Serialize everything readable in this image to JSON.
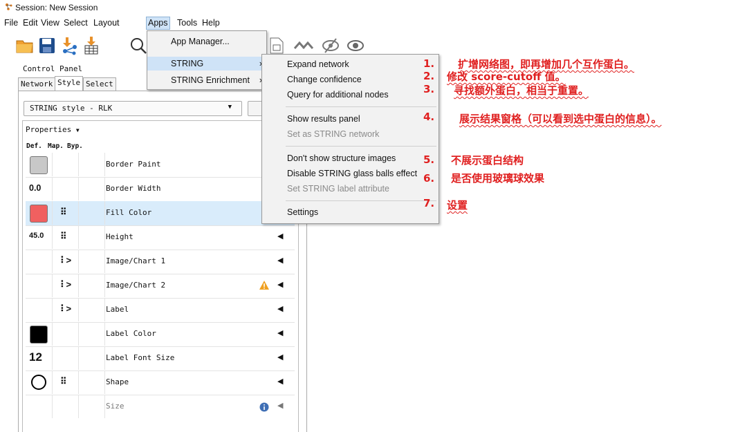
{
  "window": {
    "title": "Session: New Session"
  },
  "menubar": {
    "items": [
      "File",
      "Edit",
      "View",
      "Select",
      "Layout",
      "Apps",
      "Tools",
      "Help"
    ]
  },
  "apps_menu": {
    "items": [
      {
        "label": "App Manager...",
        "submenu": false
      },
      {
        "label": "STRING",
        "submenu": true
      },
      {
        "label": "STRING Enrichment",
        "submenu": true
      }
    ]
  },
  "string_menu": {
    "items": [
      {
        "label": "Expand network",
        "enabled": true
      },
      {
        "label": "Change confidence",
        "enabled": true
      },
      {
        "label": "Query for additional nodes",
        "enabled": true
      },
      {
        "label": "Show results panel",
        "enabled": true
      },
      {
        "label": "Set as STRING network",
        "enabled": false
      },
      {
        "label": "Don't show structure images",
        "enabled": true
      },
      {
        "label": "Disable STRING glass balls effect",
        "enabled": true
      },
      {
        "label": "Set STRING label attribute",
        "enabled": false
      },
      {
        "label": "Settings",
        "enabled": true
      }
    ]
  },
  "control_panel": {
    "title": "Control Panel",
    "tabs": [
      "Network",
      "Style",
      "Select"
    ],
    "style_selected": "STRING style - RLK",
    "properties_label": "Properties",
    "columns": [
      "Def.",
      "Map.",
      "Byp."
    ],
    "rows": [
      {
        "name": "Border Paint",
        "default": "",
        "swatch": "#c8c8c8",
        "mapping": ""
      },
      {
        "name": "Border Width",
        "default": "0.0",
        "mapping": ""
      },
      {
        "name": "Fill Color",
        "default": "",
        "swatch": "#f06060",
        "mapping": "continuous"
      },
      {
        "name": "Height",
        "default": "45.0",
        "mapping": "continuous"
      },
      {
        "name": "Image/Chart 1",
        "default": "",
        "mapping": "passthrough"
      },
      {
        "name": "Image/Chart 2",
        "default": "",
        "mapping": "passthrough",
        "warning": true
      },
      {
        "name": "Label",
        "default": "",
        "mapping": "passthrough"
      },
      {
        "name": "Label Color",
        "default": "",
        "swatch": "#000000",
        "mapping": ""
      },
      {
        "name": "Label Font Size",
        "default": "12",
        "mapping": ""
      },
      {
        "name": "Shape",
        "default": "",
        "shape": "ellipse",
        "mapping": "continuous"
      },
      {
        "name": "Size",
        "default": "",
        "mapping": "",
        "info": true
      }
    ]
  },
  "annotations": [
    {
      "num": "1.",
      "text": "扩增网络图，即再增加几个互作蛋白。"
    },
    {
      "num": "2.",
      "text": "修改 score-cutoff 值。"
    },
    {
      "num": "3.",
      "text": "寻找额外蛋白，相当于重置。"
    },
    {
      "num": "4.",
      "text": "展示结果窗格（可以看到选中蛋白的信息）。"
    },
    {
      "num": "5.",
      "text": "不展示蛋白结构"
    },
    {
      "num": "6.",
      "text": "是否使用玻璃球效果"
    },
    {
      "num": "7.",
      "text": "设置"
    }
  ],
  "colors": {
    "accent_menu_highlight": "#cfe3f7",
    "annotation_red": "#e02020",
    "selected_row": "#d9ecfb"
  }
}
